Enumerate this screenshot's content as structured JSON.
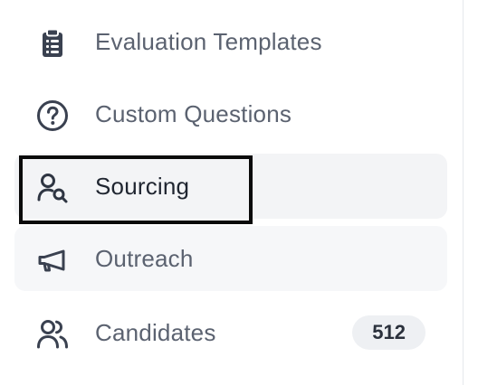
{
  "nav": {
    "evaluation_templates": {
      "label": "Evaluation Templates",
      "icon": "clipboard-icon"
    },
    "custom_questions": {
      "label": "Custom Questions",
      "icon": "help-circle-icon"
    },
    "sourcing": {
      "label": "Sourcing",
      "icon": "user-search-icon",
      "active": true,
      "focused": true
    },
    "outreach": {
      "label": "Outreach",
      "icon": "megaphone-icon"
    },
    "candidates": {
      "label": "Candidates",
      "icon": "users-icon",
      "badge": "512"
    }
  },
  "colors": {
    "label": "#5b6270",
    "active_label": "#1f2530",
    "active_bg": "#f3f4f6",
    "badge_bg": "#eef0f3",
    "focus_ring": "#0a0a0a"
  }
}
